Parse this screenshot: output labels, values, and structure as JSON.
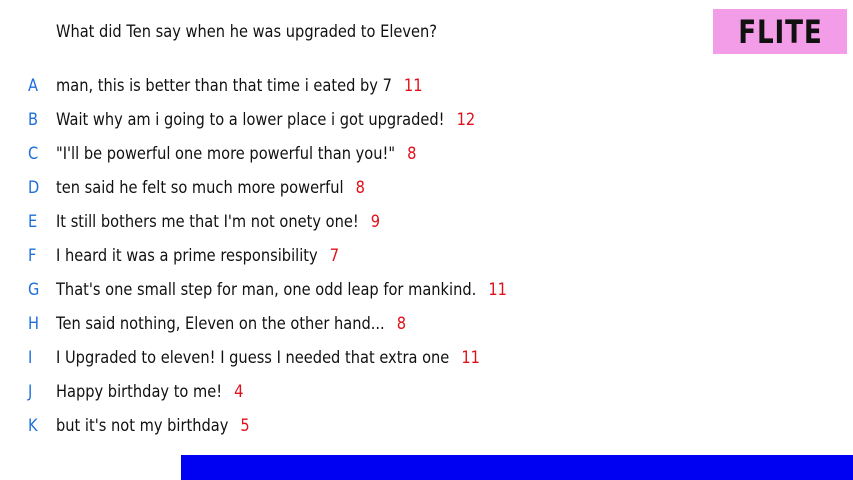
{
  "question": "What did Ten say when he was upgraded to Eleven?",
  "brand": "FLITE",
  "answers": [
    {
      "letter": "A",
      "text": "man, this is better than that time i eated by 7",
      "score": "11"
    },
    {
      "letter": "B",
      "text": "Wait why am i going to a lower place i got upgraded!",
      "score": "12"
    },
    {
      "letter": "C",
      "text": "\"I'll be powerful one more powerful than you!\"",
      "score": "8"
    },
    {
      "letter": "D",
      "text": "ten said he felt so much more powerful",
      "score": "8"
    },
    {
      "letter": "E",
      "text": "It still bothers me that I'm not onety one!",
      "score": "9"
    },
    {
      "letter": "F",
      "text": "I heard it was a prime responsibility",
      "score": "7"
    },
    {
      "letter": "G",
      "text": "That's one small step for man, one odd leap for mankind.",
      "score": "11"
    },
    {
      "letter": "H",
      "text": "Ten said nothing, Eleven on the other hand...",
      "score": "8"
    },
    {
      "letter": "I",
      "text": "I Upgraded to eleven! I guess I needed that extra one",
      "score": "11"
    },
    {
      "letter": "J",
      "text": "Happy birthday to me!",
      "score": "4"
    },
    {
      "letter": "K",
      "text": "but it's not my birthday",
      "score": "5"
    }
  ],
  "colors": {
    "letter": "#1e6fd9",
    "score": "#e0101a",
    "brand_bg": "#f39ce8",
    "bar": "#0000f2"
  }
}
